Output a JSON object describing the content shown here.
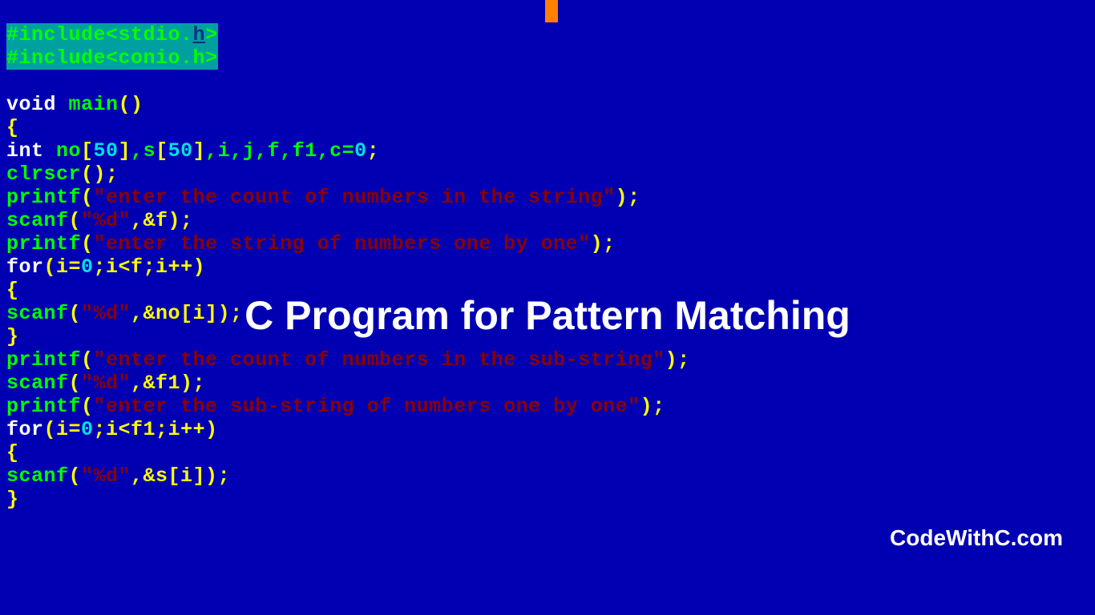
{
  "overlay_title": "C Program for Pattern Matching",
  "watermark": "CodeWithC.com",
  "code": {
    "l1": {
      "pre": "#include<stdio.",
      "u": "h",
      "post": ">"
    },
    "l2": "#include<conio.h>",
    "l4a": "void",
    "l4b": " main",
    "l4c": "()",
    "l5": "{",
    "l6a": "int",
    "l6b": " no",
    "l6c": "[",
    "l6d": "50",
    "l6e": "]",
    "l6f": ",s",
    "l6g": "[",
    "l6h": "50",
    "l6i": "]",
    "l6j": ",i,j,f,f1,c=",
    "l6k": "0",
    "l6l": ";",
    "l7a": "clrscr",
    "l7b": "();",
    "l8a": "printf",
    "l8b": "(",
    "l8c": "\"enter the count of numbers in the string\"",
    "l8d": ");",
    "l9a": "scanf",
    "l9b": "(",
    "l9c": "\"%d\"",
    "l9d": ",&f);",
    "l10a": "printf",
    "l10b": "(",
    "l10c": "\"enter the string of numbers one by one\"",
    "l10d": ");",
    "l11a": "for",
    "l11b": "(i=",
    "l11c": "0",
    "l11d": ";i<f;i++)",
    "l12": "{",
    "l13a": "scanf",
    "l13b": "(",
    "l13c": "\"%d\"",
    "l13d": ",&no[i]);",
    "l14": "}",
    "l15a": "printf",
    "l15b": "(",
    "l15c": "\"enter the count of numbers in the sub-string\"",
    "l15d": ");",
    "l16a": "scanf",
    "l16b": "(",
    "l16c": "\"%d\"",
    "l16d": ",&f1);",
    "l17a": "printf",
    "l17b": "(",
    "l17c": "\"enter the sub-string of numbers one by one\"",
    "l17d": ");",
    "l18a": "for",
    "l18b": "(i=",
    "l18c": "0",
    "l18d": ";i<f1;i++)",
    "l19": "{",
    "l20a": "scanf",
    "l20b": "(",
    "l20c": "\"%d\"",
    "l20d": ",&s[i]);",
    "l21": "}"
  }
}
